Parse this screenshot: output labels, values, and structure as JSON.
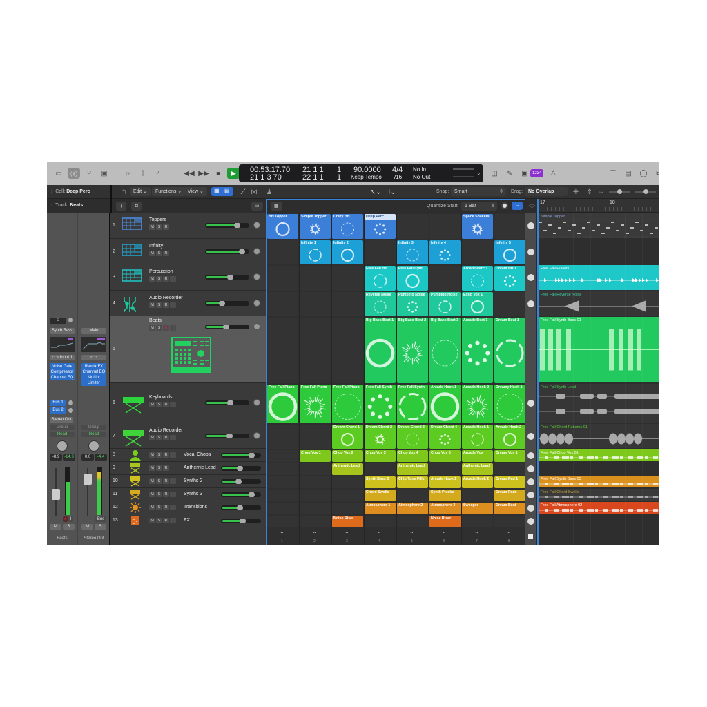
{
  "control_bar": {
    "view_buttons": [
      "library-icon",
      "inspector-icon",
      "quick-help-icon",
      "toolbar-icon"
    ],
    "edit_buttons": [
      "smart-controls-icon",
      "mixer-icon",
      "editors-icon"
    ],
    "transport": [
      "rewind",
      "fast-forward",
      "stop",
      "play",
      "record",
      "cycle"
    ],
    "lcd": {
      "time": "00:53:17.70",
      "bars_beats": "21  1  3    70",
      "pos1": "21  1  1",
      "pos1_end": "1",
      "pos2": "22  1  1",
      "pos2_end": "1",
      "tempo": "90.0000",
      "tempo_mode": "Keep Tempo",
      "signature": "4/4",
      "division": "/16",
      "input": "No In",
      "output": "No Out"
    },
    "count_in_badge": "1234",
    "right_buttons": [
      "list-icon",
      "notepad-icon",
      "loop-browser-icon",
      "browser-icon"
    ]
  },
  "toolbar": {
    "cell_label": "Cell:",
    "cell_value": "Deep Perc",
    "track_label": "Track:",
    "track_value": "Beats",
    "menus": [
      "Edit",
      "Functions",
      "View"
    ],
    "snap_label": "Snap:",
    "snap_value": "Smart",
    "drag_label": "Drag:",
    "drag_value": "No Overlap",
    "quantize_label": "Quantize Start:",
    "quantize_value": "1 Bar"
  },
  "inspector": {
    "left_strip": {
      "value_box": "0",
      "setting": "Synth Bass",
      "input": "Input 1",
      "plugins": [
        "Noise Gate",
        "Compressor",
        "Channel EQ"
      ],
      "sends": [
        "Bus 1",
        "Bus 2"
      ],
      "output": "Stereo Out",
      "group": "Group",
      "automation": "Read",
      "volume": "-8.9",
      "peak": "-14.3",
      "name": "Beats",
      "mute": "M",
      "solo": "S"
    },
    "right_strip": {
      "setting": "Main",
      "plugins": [
        "Remix FX",
        "Channel EQ",
        "Multipr",
        "Limiter"
      ],
      "group": "Group",
      "automation": "Read",
      "volume": "0.0",
      "peak": "-4.4",
      "bounce": "Bnc",
      "name": "Stereo Out",
      "mute": "M",
      "solo": "S"
    }
  },
  "tracks": [
    {
      "num": "1",
      "name": "Toppers",
      "buttons": [
        "M",
        "S",
        "R"
      ],
      "color": "#3a7fd8",
      "vol": 0.78
    },
    {
      "num": "2",
      "name": "Infinity",
      "buttons": [
        "M",
        "S",
        "R"
      ],
      "color": "#1ea9d8",
      "vol": 0.9
    },
    {
      "num": "3",
      "name": "Percussion",
      "buttons": [
        "M",
        "S",
        "R",
        "I"
      ],
      "color": "#1fc8c8",
      "vol": 0.6
    },
    {
      "num": "4",
      "name": "Audio Recorder",
      "buttons": [
        "M",
        "S",
        "R",
        "I"
      ],
      "color": "#1fc9a0",
      "vol": 0.4
    },
    {
      "num": "5",
      "name": "Beats",
      "buttons": [
        "M",
        "S",
        "R",
        "I"
      ],
      "color": "#22d15f",
      "vol": 0.5
    },
    {
      "num": "6",
      "name": "Keyboards",
      "buttons": [
        "M",
        "S",
        "R",
        "I"
      ],
      "color": "#2ed43c",
      "vol": 0.6
    },
    {
      "num": "7",
      "name": "Audio Recorder",
      "buttons": [
        "M",
        "S",
        "R",
        "I"
      ],
      "color": "#3fd43a",
      "vol": 0.58
    },
    {
      "num": "8",
      "name": "Vocal Chops",
      "buttons": [
        "M",
        "S",
        "R",
        "I"
      ],
      "color": "#7ccf1d",
      "vol": 0.82
    },
    {
      "num": "9",
      "name": "Anthemic Lead",
      "buttons": [
        "M",
        "S",
        "R"
      ],
      "color": "#a8c41e",
      "vol": 0.5
    },
    {
      "num": "10",
      "name": "Synths 2",
      "buttons": [
        "M",
        "S",
        "R",
        "I"
      ],
      "color": "#d0c020",
      "vol": 0.47
    },
    {
      "num": "11",
      "name": "Synths 3",
      "buttons": [
        "M",
        "S",
        "R",
        "I"
      ],
      "color": "#d4ac1e",
      "vol": 0.83
    },
    {
      "num": "12",
      "name": "Transitions",
      "buttons": [
        "M",
        "S",
        "R",
        "I"
      ],
      "color": "#e39222",
      "vol": 0.5
    },
    {
      "num": "13",
      "name": "FX",
      "buttons": [
        "M",
        "S",
        "R",
        "I"
      ],
      "color": "#e06a1d",
      "vol": 0.58
    }
  ],
  "cells": [
    [
      {
        "name": "HH Topper",
        "c": "#3b7fd9"
      },
      {
        "name": "Simple Topper",
        "c": "#3b7fd9"
      },
      {
        "name": "Crazy HH",
        "c": "#3b7fd9"
      },
      {
        "name": "Deep Perc",
        "c": "#3b7fd9",
        "sel": true
      },
      null,
      null,
      {
        "name": "Space Shakers",
        "c": "#3b7fd9"
      },
      null
    ],
    [
      null,
      {
        "name": "Infinity 1",
        "c": "#1ca0d6"
      },
      {
        "name": "Infinity 2",
        "c": "#1ca0d6"
      },
      null,
      {
        "name": "Infinity 3",
        "c": "#1ca0d6"
      },
      {
        "name": "Infinity 4",
        "c": "#1ca0d6"
      },
      null,
      {
        "name": "Infinity 5",
        "c": "#1ca0d6"
      }
    ],
    [
      null,
      null,
      null,
      {
        "name": "Free Fall HH",
        "c": "#1cc8c6"
      },
      {
        "name": "Free Fall Cym",
        "c": "#1cc8c6"
      },
      null,
      {
        "name": "Arcade Perc 1",
        "c": "#1cc8c6"
      },
      {
        "name": "Dream HH 1",
        "c": "#1cc8c6"
      }
    ],
    [
      null,
      null,
      null,
      {
        "name": "Reverse Noise",
        "c": "#1fc99b"
      },
      {
        "name": "Pumping Noise",
        "c": "#1fc99b"
      },
      {
        "name": "Pumping Noise",
        "c": "#1fc99b"
      },
      {
        "name": "Echo Vox 1",
        "c": "#1fc99b"
      },
      null
    ],
    [
      null,
      null,
      null,
      {
        "name": "Big Bass Beat 1",
        "c": "#21c95e"
      },
      {
        "name": "Big Bass Beat 2",
        "c": "#21c95e"
      },
      {
        "name": "Big Bass Beat 3",
        "c": "#21c95e"
      },
      {
        "name": "Arcade Beat 1",
        "c": "#21c95e"
      },
      {
        "name": "Dream Beat 1",
        "c": "#21c95e"
      }
    ],
    [
      {
        "name": "Free Fall Piano",
        "c": "#2dcb3c"
      },
      {
        "name": "Free Fall Piano",
        "c": "#2dcb3c"
      },
      {
        "name": "Free Fall Piano",
        "c": "#2dcb3c"
      },
      {
        "name": "Free Fall Synth",
        "c": "#2dcb3c"
      },
      {
        "name": "Free Fall Synth",
        "c": "#2dcb3c"
      },
      {
        "name": "Arcade Hook 1",
        "c": "#2dcb3c"
      },
      {
        "name": "Arcade Hook 2",
        "c": "#2dcb3c"
      },
      {
        "name": "Dreamy Hook 1",
        "c": "#2dcb3c"
      }
    ],
    [
      null,
      null,
      {
        "name": "Dream Chord 1",
        "c": "#5ccb22"
      },
      {
        "name": "Dream Chord 2",
        "c": "#5ccb22"
      },
      {
        "name": "Dream Chord 3",
        "c": "#5ccb22"
      },
      {
        "name": "Dream Chord 4",
        "c": "#5ccb22"
      },
      {
        "name": "Arcade Hook 1",
        "c": "#5ccb22"
      },
      {
        "name": "Arcade Hook 2",
        "c": "#5ccb22"
      }
    ],
    [
      null,
      {
        "name": "Chop Vox 1",
        "c": "#7ec81c"
      },
      {
        "name": "Chop Vox 2",
        "c": "#7ec81c"
      },
      {
        "name": "Chop Vox 3",
        "c": "#7ec81c"
      },
      {
        "name": "Chop Vox 4",
        "c": "#7ec81c"
      },
      {
        "name": "Chop Vox 5",
        "c": "#7ec81c"
      },
      {
        "name": "Arcade Vox",
        "c": "#7ec81c"
      },
      {
        "name": "Dream Vox 1",
        "c": "#7ec81c"
      }
    ],
    [
      null,
      null,
      {
        "name": "Anthemic Lead",
        "c": "#a6c41c"
      },
      null,
      {
        "name": "Anthemic Lead",
        "c": "#a6c41c"
      },
      null,
      {
        "name": "Anthemic Lead",
        "c": "#a6c41c"
      },
      null
    ],
    [
      null,
      null,
      null,
      {
        "name": "Synth Bass 5",
        "c": "#cdc11e"
      },
      {
        "name": "Chip Tune Fills",
        "c": "#cdc11e"
      },
      {
        "name": "Arcade Hook 1",
        "c": "#cdc11e"
      },
      {
        "name": "Arcade Hook 2",
        "c": "#cdc11e"
      },
      {
        "name": "Dream Pad 1",
        "c": "#cdc11e"
      }
    ],
    [
      null,
      null,
      null,
      {
        "name": "Chord Swells",
        "c": "#d3aa1d"
      },
      null,
      {
        "name": "Synth Plucks",
        "c": "#d3aa1d"
      },
      null,
      {
        "name": "Dream Pads",
        "c": "#d3aa1d"
      }
    ],
    [
      null,
      null,
      null,
      {
        "name": "Atmosphere 1",
        "c": "#de8d1f"
      },
      {
        "name": "Atmosphere 2",
        "c": "#de8d1f"
      },
      {
        "name": "Atmosphere 3",
        "c": "#de8d1f"
      },
      {
        "name": "Sweeper",
        "c": "#de8d1f"
      },
      {
        "name": "Dream Beat",
        "c": "#de8d1f"
      }
    ],
    [
      null,
      null,
      {
        "name": "Noise Riser",
        "c": "#de6a1c"
      },
      null,
      null,
      {
        "name": "Noise Riser",
        "c": "#de6a1c"
      },
      null,
      null
    ]
  ],
  "scenes": [
    "1",
    "2",
    "3",
    "4",
    "5",
    "6",
    "7",
    "8"
  ],
  "timeline": {
    "ruler": [
      "17",
      "18"
    ],
    "regions": [
      {
        "name": "Simple Topper",
        "bg": "#3a3a3a",
        "fg": "#8aa9d8",
        "type": "midi"
      },
      null,
      {
        "name": "Free Fall Hi Hats",
        "bg": "#1ec8c8",
        "fg": "#ffffff",
        "type": "hits"
      },
      {
        "name": "Free Fall Reverse Noise",
        "bg": "#363636",
        "fg": "#3fd3a6",
        "type": "reverse"
      },
      {
        "name": "Free Fall Synth Bass 01",
        "bg": "#22c95e",
        "fg": "#ffffff",
        "type": "bass"
      },
      {
        "name": "Free Fall Synth Lead",
        "bg": "#363636",
        "fg": "#3fd24c",
        "type": "lead"
      },
      {
        "name": "Free Fall Chord Patterns 01",
        "bg": "#363636",
        "fg": "#5bd033",
        "type": "chord"
      },
      {
        "name": "Free Fall Chop Vox 01",
        "bg": "#7ec81c",
        "fg": "#ffffff",
        "type": "thin"
      },
      null,
      {
        "name": "Free Fall Synth Bass 03",
        "bg": "#d9901c",
        "fg": "#ffffff",
        "type": "thin"
      },
      {
        "name": "Free Fall Chord Swells",
        "bg": "#3a3a3a",
        "fg": "#c2a23d",
        "type": "thin"
      },
      {
        "name": "Free Fall Atmosphere 02",
        "bg": "#d9481c",
        "fg": "#ffffff",
        "type": "thin"
      },
      null
    ]
  }
}
